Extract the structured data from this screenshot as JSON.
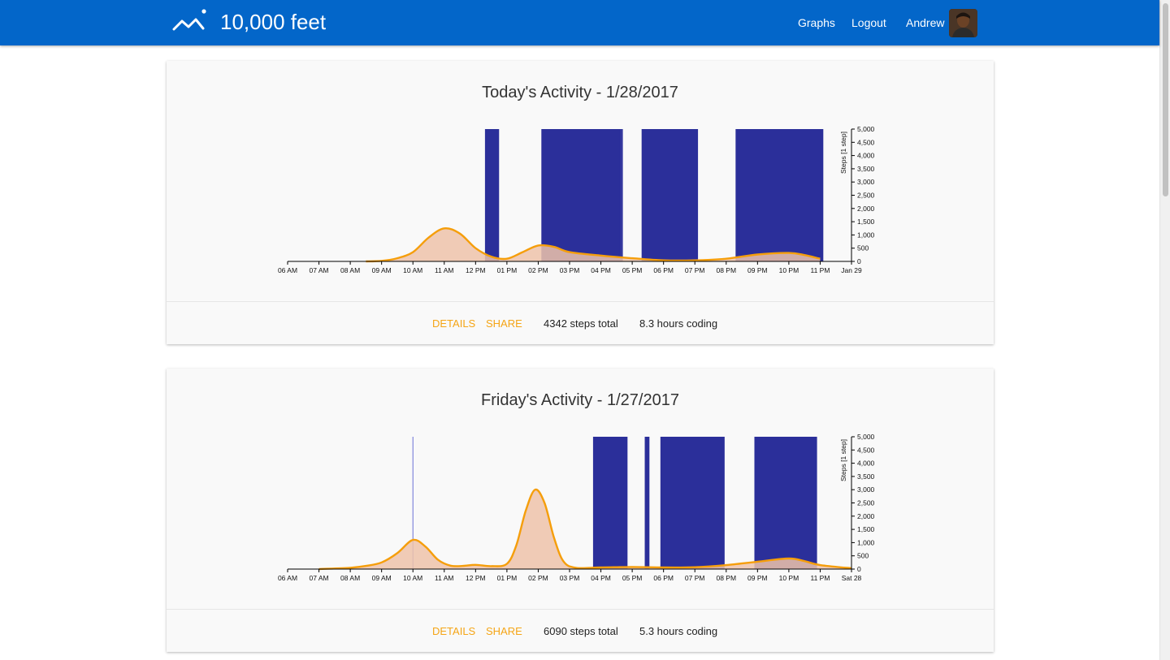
{
  "header": {
    "brand": "10,000 feet",
    "nav": {
      "graphs": "Graphs",
      "logout": "Logout",
      "user": "Andrew"
    }
  },
  "colors": {
    "header": "#0366c9",
    "coding": "#2b2f9a",
    "steps_line": "#f59e0b",
    "steps_fill": "#efc3aa",
    "action": "#f5a516"
  },
  "cards": [
    {
      "title": "Today's Activity - 1/28/2017",
      "actions": {
        "details": "DETAILS",
        "share": "SHARE"
      },
      "stats": {
        "steps": "4342 steps total",
        "coding": "8.3 hours coding"
      },
      "chart_data": {
        "type": "area",
        "x_ticks": [
          "06 AM",
          "07 AM",
          "08 AM",
          "09 AM",
          "10 AM",
          "11 AM",
          "12 PM",
          "01 PM",
          "02 PM",
          "03 PM",
          "04 PM",
          "05 PM",
          "06 PM",
          "07 PM",
          "08 PM",
          "09 PM",
          "10 PM",
          "11 PM",
          "Jan 29"
        ],
        "xlim_hours": [
          6,
          24
        ],
        "ylabel": "Steps [1 step]",
        "ylim": [
          0,
          5000
        ],
        "y_ticks": [
          "0",
          "500",
          "1,000",
          "1,500",
          "2,000",
          "2,500",
          "3,000",
          "3,500",
          "4,000",
          "4,500",
          "5,000"
        ],
        "coding_blocks": [
          [
            12.3,
            12.75
          ],
          [
            14.1,
            16.65
          ],
          [
            16.65,
            16.7
          ],
          [
            17.3,
            19.1
          ],
          [
            20.3,
            23.1
          ]
        ],
        "steps_series": [
          [
            8.5,
            0
          ],
          [
            9,
            20
          ],
          [
            9.5,
            120
          ],
          [
            10,
            350
          ],
          [
            10.5,
            900
          ],
          [
            11,
            1250
          ],
          [
            11.5,
            1050
          ],
          [
            12,
            500
          ],
          [
            12.5,
            180
          ],
          [
            13,
            100
          ],
          [
            13.5,
            350
          ],
          [
            14,
            600
          ],
          [
            14.5,
            550
          ],
          [
            15,
            350
          ],
          [
            16,
            220
          ],
          [
            17,
            120
          ],
          [
            18,
            40
          ],
          [
            19,
            40
          ],
          [
            20,
            100
          ],
          [
            21,
            260
          ],
          [
            22,
            320
          ],
          [
            22.5,
            240
          ],
          [
            23,
            100
          ]
        ],
        "series": [
          {
            "name": ""
          }
        ]
      }
    },
    {
      "title": "Friday's Activity - 1/27/2017",
      "actions": {
        "details": "DETAILS",
        "share": "SHARE"
      },
      "stats": {
        "steps": "6090 steps total",
        "coding": "5.3 hours coding"
      },
      "chart_data": {
        "type": "area",
        "x_ticks": [
          "06 AM",
          "07 AM",
          "08 AM",
          "09 AM",
          "10 AM",
          "11 AM",
          "12 PM",
          "01 PM",
          "02 PM",
          "03 PM",
          "04 PM",
          "05 PM",
          "06 PM",
          "07 PM",
          "08 PM",
          "09 PM",
          "10 PM",
          "11 PM",
          "Sat 28"
        ],
        "xlim_hours": [
          6,
          24
        ],
        "ylabel": "Steps [1 step]",
        "ylim": [
          0,
          5000
        ],
        "y_ticks": [
          "0",
          "500",
          "1,000",
          "1,500",
          "2,000",
          "2,500",
          "3,000",
          "3,500",
          "4,000",
          "4,500",
          "5,000"
        ],
        "coding_blocks": [
          [
            15.75,
            16.85
          ],
          [
            17.4,
            17.55
          ],
          [
            17.9,
            19.95
          ],
          [
            20.9,
            22.9
          ]
        ],
        "marker_hour": 10,
        "steps_series": [
          [
            7,
            0
          ],
          [
            8,
            50
          ],
          [
            8.5,
            120
          ],
          [
            9,
            250
          ],
          [
            9.5,
            600
          ],
          [
            10,
            1100
          ],
          [
            10.4,
            850
          ],
          [
            10.8,
            350
          ],
          [
            11.2,
            130
          ],
          [
            11.6,
            120
          ],
          [
            12,
            160
          ],
          [
            12.5,
            110
          ],
          [
            13,
            200
          ],
          [
            13.3,
            900
          ],
          [
            13.6,
            2200
          ],
          [
            13.9,
            3000
          ],
          [
            14.2,
            2500
          ],
          [
            14.5,
            1200
          ],
          [
            14.8,
            300
          ],
          [
            15.2,
            50
          ],
          [
            16,
            60
          ],
          [
            17,
            80
          ],
          [
            18,
            60
          ],
          [
            19,
            70
          ],
          [
            20,
            150
          ],
          [
            21,
            280
          ],
          [
            22,
            400
          ],
          [
            22.5,
            300
          ],
          [
            23,
            150
          ],
          [
            24,
            30
          ]
        ],
        "series": [
          {
            "name": ""
          }
        ]
      }
    }
  ]
}
